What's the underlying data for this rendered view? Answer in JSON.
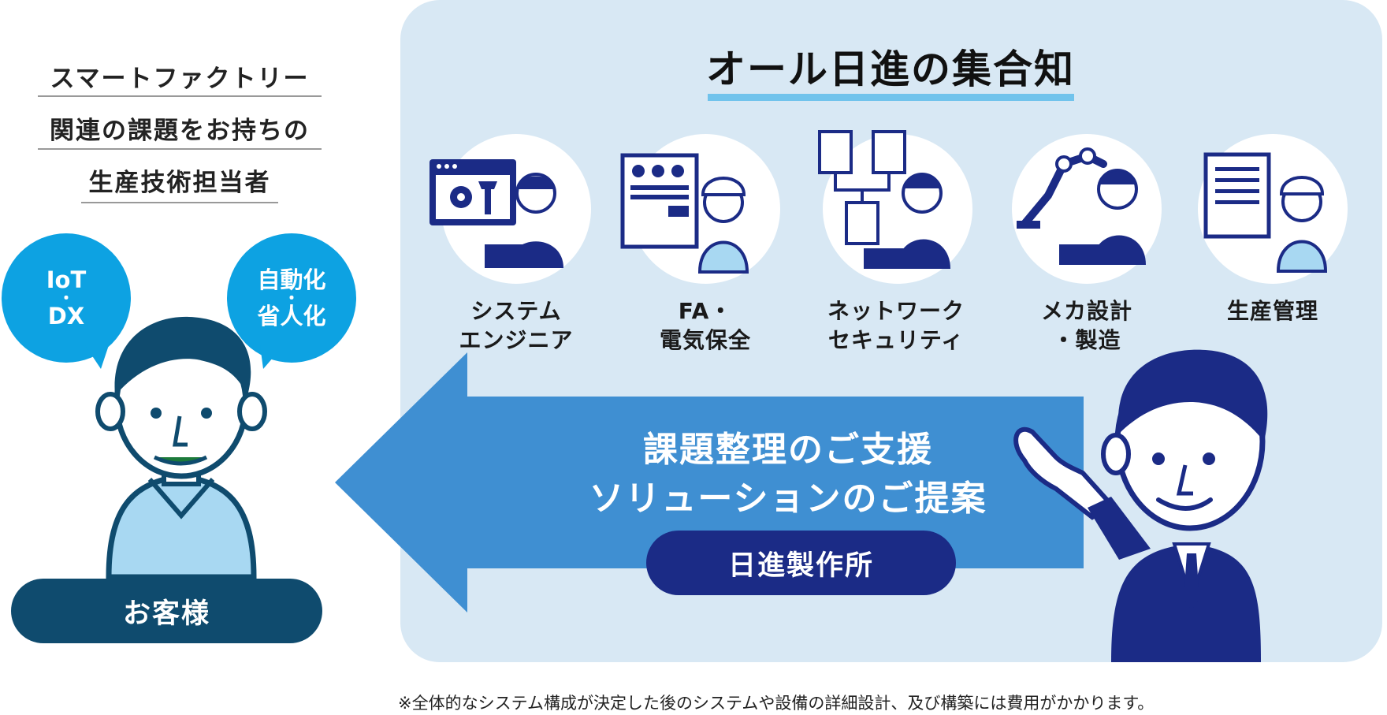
{
  "customer_heading": {
    "lines": [
      "スマートファクトリー",
      "関連の課題をお持ちの",
      "生産技術担当者"
    ]
  },
  "bubbles": {
    "left": {
      "line1": "IoT",
      "dot": "・",
      "line2": "DX"
    },
    "right": {
      "line1": "自動化",
      "dot": "・",
      "line2": "省人化"
    }
  },
  "customer_label": "お客様",
  "main_title": "オール日進の集合知",
  "roles": [
    {
      "line1": "システム",
      "line2": "エンジニア"
    },
    {
      "line1": "FA・",
      "line2": "電気保全"
    },
    {
      "line1": "ネットワーク",
      "line2": "セキュリティ"
    },
    {
      "line1": "メカ設計",
      "line2": "・製造"
    },
    {
      "line1": "生産管理",
      "line2": ""
    }
  ],
  "support_message": {
    "line1": "課題整理のご支援",
    "line2": "ソリューションのご提案"
  },
  "company_label": "日進製作所",
  "footnote": "※全体的なシステム構成が決定した後のシステムや設備の詳細設計、及び構築には費用がかかります。",
  "colors": {
    "panel_bg": "#d8e8f4",
    "arrow": "#3f8fd2",
    "bubble": "#0da2e2",
    "navy": "#1b2b86",
    "customer_dark": "#0f4b6e",
    "accent_line": "#71c3ec"
  }
}
